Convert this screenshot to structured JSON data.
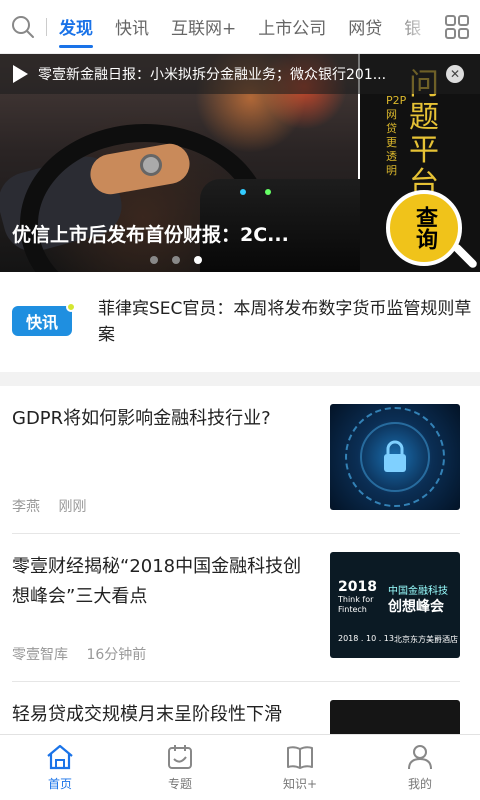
{
  "nav": {
    "tabs": [
      "发现",
      "快讯",
      "互联网+",
      "上市公司",
      "网贷",
      "银"
    ],
    "active_index": 0
  },
  "banner": {
    "ticker": "零壹新金融日报：小米拟拆分金融业务；微众银行201...",
    "caption": "优信上市后发布首份财报：2C...",
    "dots": 3,
    "active_dot": 2,
    "side_ad": {
      "stripe": "P2P网贷更透明",
      "title": "问题平台",
      "badge": "查询"
    }
  },
  "flash": {
    "badge": "快讯",
    "text": "菲律宾SEC官员：本周将发布数字货币监管规则草案"
  },
  "articles": [
    {
      "title": "GDPR将如何影响金融科技行业?",
      "author": "李燕",
      "time": "刚刚"
    },
    {
      "title": "零壹财经揭秘“2018中国金融科技创想峰会”三大看点",
      "author": "零壹智库",
      "time": "16分钟前",
      "thumb": {
        "year": "2018",
        "en1": "Think for",
        "en2": "Fintech",
        "cn1": "中国金融科技",
        "cn2": "创想峰会",
        "date": "2018 . 10 . 13",
        "venue": "北京东方美爵酒店"
      }
    },
    {
      "title": "轻易贷成交规模月末呈阶段性下滑",
      "author": "",
      "time": ""
    }
  ],
  "bottom_nav": [
    {
      "label": "首页",
      "icon": "home-icon"
    },
    {
      "label": "专题",
      "icon": "calendar-icon"
    },
    {
      "label": "知识+",
      "icon": "book-icon"
    },
    {
      "label": "我的",
      "icon": "user-icon"
    }
  ],
  "colors": {
    "accent": "#1a73e8",
    "flash_badge": "#1f8fe0",
    "ad_yellow": "#f0c31a"
  }
}
